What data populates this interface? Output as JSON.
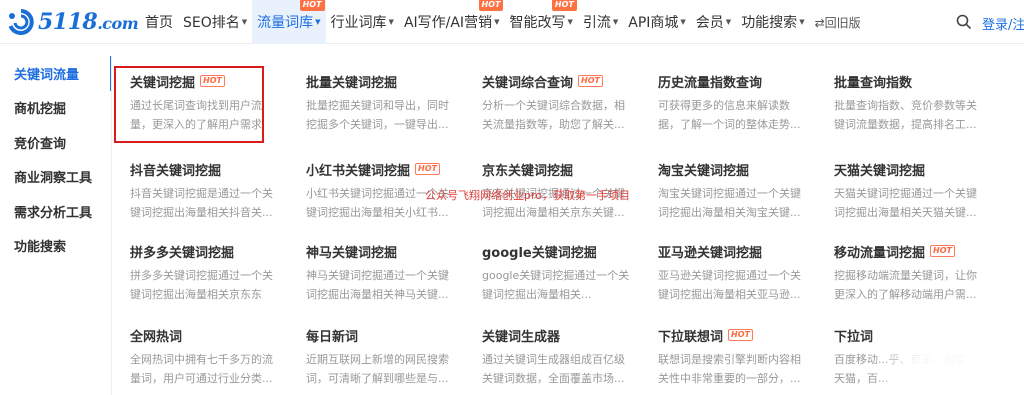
{
  "header": {
    "logo_text": "5118",
    "logo_suffix": ".com",
    "nav": [
      {
        "label": "首页",
        "caret": false,
        "hot": false,
        "active": false
      },
      {
        "label": "SEO排名",
        "caret": true,
        "hot": false,
        "active": false
      },
      {
        "label": "流量词库",
        "caret": true,
        "hot": true,
        "active": true
      },
      {
        "label": "行业词库",
        "caret": true,
        "hot": false,
        "active": false
      },
      {
        "label": "AI写作/AI营销",
        "caret": true,
        "hot": true,
        "active": false
      },
      {
        "label": "智能改写",
        "caret": true,
        "hot": true,
        "active": false
      },
      {
        "label": "引流",
        "caret": true,
        "hot": false,
        "active": false
      },
      {
        "label": "API商城",
        "caret": true,
        "hot": false,
        "active": false
      },
      {
        "label": "会员",
        "caret": true,
        "hot": false,
        "active": false
      },
      {
        "label": "功能搜索",
        "caret": true,
        "hot": false,
        "active": false
      }
    ],
    "hot_label": "HOT",
    "switch_old": "⇄回旧版",
    "login": "登录/注册"
  },
  "sidebar": {
    "items": [
      {
        "label": "关键词流量",
        "active": true
      },
      {
        "label": "商机挖掘",
        "active": false
      },
      {
        "label": "竞价查询",
        "active": false
      },
      {
        "label": "商业洞察工具",
        "active": false
      },
      {
        "label": "需求分析工具",
        "active": false
      },
      {
        "label": "功能搜索",
        "active": false
      }
    ]
  },
  "cards": {
    "hot_label": "HOT",
    "rows": [
      [
        {
          "title": "关键词挖掘",
          "hot": true,
          "desc": "通过长尾词查询找到用户流量，更深入的了解用户需求"
        },
        {
          "title": "批量关键词挖掘",
          "hot": false,
          "desc": "批量挖掘关键词和导出，同时挖掘多个关键词，一键导出..."
        },
        {
          "title": "关键词综合查询",
          "hot": true,
          "desc": "分析一个关键词综合数据，相关流量指数等，助您了解关..."
        },
        {
          "title": "历史流量指数查询",
          "hot": false,
          "desc": "可获得更多的信息来解读数据，了解一个词的整体走势..."
        },
        {
          "title": "批量查询指数",
          "hot": false,
          "desc": "批量查询指数、竞价参数等关键词流量数据，提高排名工..."
        }
      ],
      [
        {
          "title": "抖音关键词挖掘",
          "hot": false,
          "desc": "抖音关键词挖掘是通过一个关键词挖掘出海量相关抖音关..."
        },
        {
          "title": "小红书关键词挖掘",
          "hot": true,
          "desc": "小红书关键词挖掘通过一个关键词挖掘出海量相关小红书..."
        },
        {
          "title": "京东关键词挖掘",
          "hot": false,
          "desc": "京东关键词挖掘通过一个关键词挖掘出海量相关京东关键..."
        },
        {
          "title": "淘宝关键词挖掘",
          "hot": false,
          "desc": "淘宝关键词挖掘通过一个关键词挖掘出海量相关淘宝关键..."
        },
        {
          "title": "天猫关键词挖掘",
          "hot": false,
          "desc": "天猫关键词挖掘通过一个关键词挖掘出海量相关天猫关键..."
        }
      ],
      [
        {
          "title": "拼多多关键词挖掘",
          "hot": false,
          "desc": "拼多多关键词挖掘通过一个关键词挖掘出海量相关京东东关..."
        },
        {
          "title": "神马关键词挖掘",
          "hot": false,
          "desc": "神马关键词挖掘通过一个关键词挖掘出海量相关神马关键..."
        },
        {
          "title": "google关键词挖掘",
          "hot": false,
          "desc": "google关键词挖掘通过一个关键词挖掘出海量相关..."
        },
        {
          "title": "亚马逊关键词挖掘",
          "hot": false,
          "desc": "亚马逊关键词挖掘通过一个关键词挖掘出海量相关亚马逊..."
        },
        {
          "title": "移动流量词挖掘",
          "hot": true,
          "desc": "挖掘移动端流量关键词，让你更深入的了解移动端用户需..."
        }
      ],
      [
        {
          "title": "全网热词",
          "hot": false,
          "desc": "全网热词中拥有七千多万的流量词，用户可通过行业分类..."
        },
        {
          "title": "每日新词",
          "hot": false,
          "desc": "近期互联网上新增的网民搜索词，可清晰了解到哪些是与..."
        },
        {
          "title": "关键词生成器",
          "hot": false,
          "desc": "通过关键词生成器组成百亿级关键词数据，全面覆盖市场..."
        },
        {
          "title": "下拉联想词",
          "hot": true,
          "desc": "联想词是搜索引擎判断内容相关性中非常重要的一部分，..."
        },
        {
          "title": "下拉词",
          "hot": false,
          "desc": "百度移动...乎、京东、淘宝、天猫，百..."
        }
      ]
    ]
  },
  "watermark": "公众号飞翔网络创业pro，获取第一手项目",
  "colors": {
    "accent": "#1f6fe0",
    "hot": "#ff6a40",
    "highlight_box": "#d91b1b"
  }
}
